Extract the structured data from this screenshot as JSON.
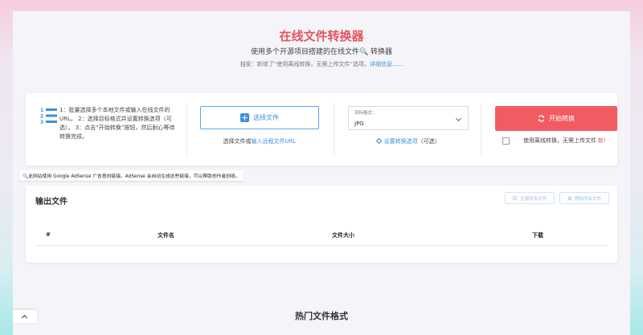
{
  "header": {
    "title": "在线文件转换器",
    "subtitle": "使用多个开源项目搭建的在线文件🔍 转换器",
    "notice_text": "独家：新增了“使用离线转换，无需上传文件”选项。",
    "notice_link": "详细信息......"
  },
  "steps": {
    "icon": "numbered-list-icon",
    "text": "1：批量选择多个本地文件或输入在线文件的URL。 2：选择目标格式并设置转换选项（可选）。 3：点击“开始转换”按钮，然后耐心等待转换完成。"
  },
  "file_select": {
    "button_label": "选择文件",
    "or_text": "选择文件或",
    "url_link": "输入远程文件URL"
  },
  "format": {
    "label": "目标格式：",
    "selected": "JPG",
    "settings_link": "设置转换选项",
    "settings_suffix": "（可选）"
  },
  "convert": {
    "start_label": "开始转换",
    "offline_text": "使用离线转换，无需上传文件",
    "new_badge": "新!"
  },
  "ad_note": "🔍此网站使用 Google AdSense 广告意向链接。AdSense 会自动生成这些链接，可以帮助创作者创收。",
  "output": {
    "title": "输出文件",
    "compress_all": "压缩所有文件",
    "delete_all": "删除所有文件",
    "columns": [
      "#",
      "文件名",
      "文件大小",
      "下载"
    ]
  },
  "footer": {
    "section_title": "热门文件格式"
  },
  "colors": {
    "accent_red": "#f35b62",
    "link_blue": "#3d8fe0"
  }
}
